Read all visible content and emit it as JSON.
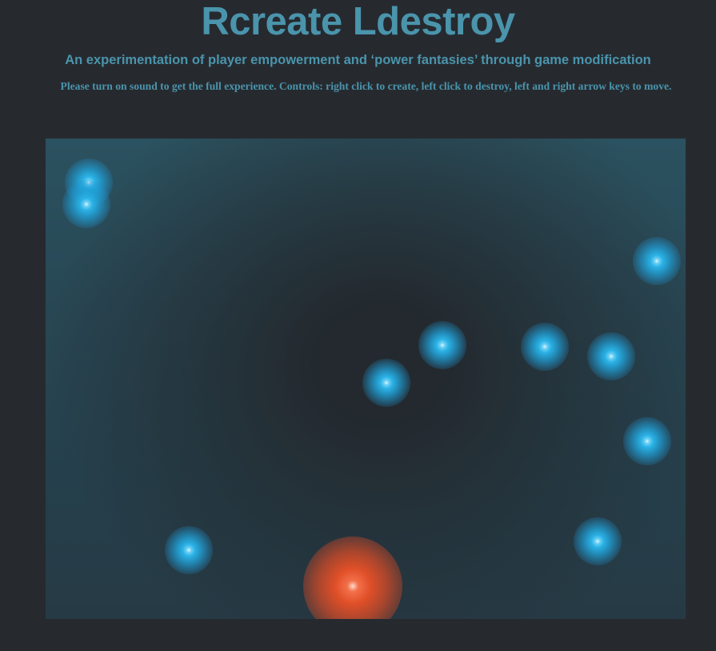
{
  "header": {
    "title": "Rcreate Ldestroy",
    "subtitle": "An experimentation of player empowerment and ‘power fantasies’ through game modification",
    "instructions": "Please turn on sound to get the full experience. Controls: right click to create, left click to destroy, left and right arrow keys to move."
  },
  "colors": {
    "page_background": "#262a2f",
    "text": "#4a94ac",
    "orb": "#2ab2e6",
    "player": "#e04f28"
  },
  "game": {
    "orb_count": 11,
    "player": "red-player-orb"
  }
}
